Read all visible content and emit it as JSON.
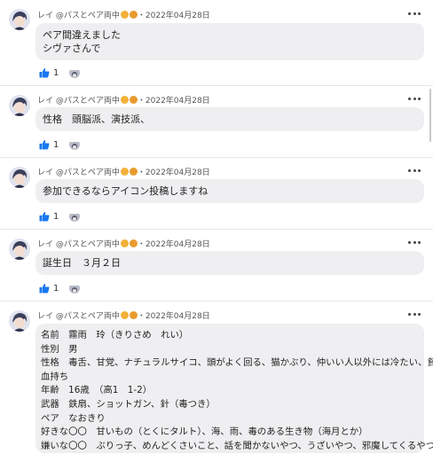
{
  "posts": [
    {
      "author": "レイ @パスとペア両中",
      "date": "2022年04月28日",
      "lines": [
        "ペア間違えました",
        "シヴァさんで"
      ],
      "likes": "1"
    },
    {
      "author": "レイ @パスとペア両中",
      "date": "2022年04月28日",
      "lines": [
        "性格　頭脳派、演技派、"
      ],
      "likes": "1"
    },
    {
      "author": "レイ @パスとペア両中",
      "date": "2022年04月28日",
      "lines": [
        "参加できるならアイコン投稿しますね"
      ],
      "likes": "1"
    },
    {
      "author": "レイ @パスとペア両中",
      "date": "2022年04月28日",
      "lines": [
        "誕生日　３月２日"
      ],
      "likes": "1"
    },
    {
      "author": "レイ @パスとペア両中",
      "date": "2022年04月28日",
      "lines": [
        "名前　霧雨　玲（きりさめ　れい）",
        "性別　男",
        "性格　毒舌、甘党、ナチュラルサイコ、頭がよく回る、猫かぶり、仲いい人以外には冷たい、貧",
        "血持ち",
        "年齢　16歳　（高1　1-2）",
        "武器　鉄扇、ショットガン、針（毒つき）",
        "ペア　なおきり",
        "好きな〇〇　甘いもの（とくにタルト）、海、雨、毒のある生き物（海月とか）",
        "嫌いな〇〇　ぶりっ子、めんどくさいこと、話を聞かないやつ、うざいやつ、邪魔してくるやつ"
      ],
      "likes": ""
    }
  ],
  "colors": {
    "like_blue": "#1877f2",
    "bubble_bg": "#efeff1"
  },
  "icons": {
    "like": "thumbs-up-icon",
    "more": "more-horizontal-icon"
  }
}
